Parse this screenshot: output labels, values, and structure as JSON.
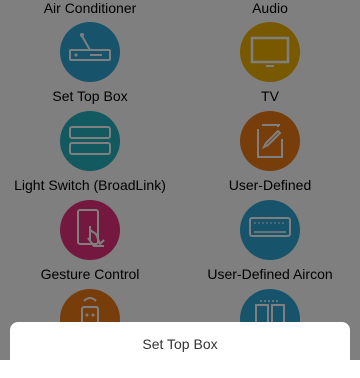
{
  "devices": [
    {
      "label": "Air Conditioner",
      "icon": "air-conditioner-icon",
      "color": "#2ea7d6"
    },
    {
      "label": "Audio",
      "icon": "audio-icon",
      "color": "#f2b200"
    },
    {
      "label": "Set Top Box",
      "icon": "set-top-box-icon",
      "color": "#2ea7d6"
    },
    {
      "label": "TV",
      "icon": "tv-icon",
      "color": "#f2b200"
    },
    {
      "label": "Light Switch (BroadLink)",
      "icon": "light-switch-icon",
      "color": "#27b2c0"
    },
    {
      "label": "User-Defined",
      "icon": "user-defined-icon",
      "color": "#ee7b16"
    },
    {
      "label": "Gesture Control",
      "icon": "gesture-icon",
      "color": "#e8317f"
    },
    {
      "label": "User-Defined Aircon",
      "icon": "user-defined-aircon-icon",
      "color": "#2ea7d6"
    },
    {
      "label": "",
      "icon": "remote-icon",
      "color": "#ee7b16"
    },
    {
      "label": "",
      "icon": "device-icon",
      "color": "#2ea7d6"
    }
  ],
  "sheet": {
    "title": "Set Top Box"
  }
}
